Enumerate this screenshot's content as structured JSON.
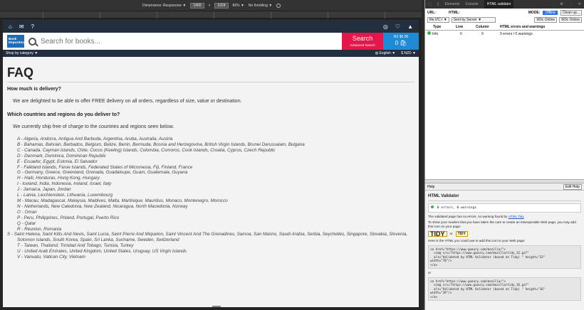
{
  "devbar": {
    "mode": "Dimensions: Responsive ▼",
    "width": "1400",
    "x": "×",
    "height": "1024",
    "zoom": "86% ▼",
    "throttle": "No throttling ▼"
  },
  "store": {
    "search_placeholder": "Search for books...",
    "search_button": "Search",
    "advanced": "Advanced Search",
    "basket_total": "NZ $0.00",
    "basket_count": "0",
    "logo_line1": "Book",
    "logo_line2": "Depository",
    "shop_by_category": "Shop by category ▼",
    "language": "English ▼",
    "currency": "$ NZD ▼"
  },
  "faq": {
    "title": "FAQ",
    "q1": "How much is delivery?",
    "a1": "We are delighted to be able to offer FREE delivery on all orders, regardless of size, value or destination.",
    "q2": "Which countries and regions do you deliver to?",
    "a2": "We currently ship free of charge to the countries and regions seen below.",
    "countries": [
      "A - Algeria, Andorra, Antigua And Barbuda, Argentina, Aruba, Australia, Austria",
      "B - Bahamas, Bahrain, Barbados, Belgium, Belize, Benin, Bermuda, Bosnia and Herzegovina, British Virgin Islands, Brunei Darussalam, Bulgaria",
      "C - Canada, Cayman Islands, Chile, Cocos (Keeling) Islands, Colombia, Comoros, Cook Islands, Croatia, Cyprus, Czech Republic",
      "D - Denmark, Dominica, Dominican Republic",
      "E - Ecuador, Egypt, Estonia, El Salvador",
      "F - Falkland Islands, Faroe Islands, Federated States of Micronesia, Fiji, Finland, France",
      "G - Germany, Greece, Greenland, Grenada, Guadaloupe, Guam, Guatemala, Guyana",
      "H - Haiti, Honduras, Hong Kong, Hungary",
      "I - Iceland, India, Indonesia, Ireland, Israel, Italy",
      "J - Jamaica, Japan, Jordan",
      "L - Latvia, Liechtenstein, Lithuania, Luxembourg",
      "M - Macau, Madagascar, Malaysia, Maldives, Malta, Martinique, Mauritius, Monaco, Montenegro, Morocco",
      "N - Netherlands, New Caledonia, New Zealand, Nicaragua, North Macedonia, Norway",
      "O - Oman",
      "P - Peru, Philippines, Poland, Portugal, Puerto Rico",
      "Q - Qatar",
      "R - Reunion, Romania",
      "S - Saint Helena, Saint Kitts And Nevis, Saint Lucia, Saint Pierre And Miquelon, Saint Vincent And The Grenadines, Samoa, San Marino, Saudi Arabia, Serbia, Seychelles, Singapore, Slovakia, Slovenia, Solomon Islands, South Korea, Spain, Sri Lanka, Suriname, Sweden, Switzerland",
      "T - Taiwan, Thailand, Trinidad And Tobago, Tunisia, Turkey",
      "U - United Arab Emirates, United Kingdom, United States, Uruguay, US Virgin Islands",
      "V - Vanuatu, Vatican City, Vietnam"
    ]
  },
  "devtools": {
    "tabs": [
      "Elements",
      "Console",
      "HTML validator"
    ],
    "url_label": "URL:",
    "html_label": "HTML:",
    "mode_label": "MODE:",
    "mode_value": "Offline",
    "clean_button": "Clean up...",
    "url_value": "file:///C:/ ▼",
    "html_value": "Sent by Server ▼",
    "w3c_1": "W3c Online",
    "w3c_2": "W3c Online",
    "col_type": "Type",
    "col_line": "Line",
    "col_column": "Column",
    "col_html": "HTML errors and warnings",
    "row_type": "Info",
    "row_line": "0",
    "row_col": "0",
    "row_msg": "0 errors / 0 warnings",
    "help_label": "Help",
    "edit_help": "Edit Help",
    "validator_title": "HTML Validator",
    "status": "0 errors, 0 warnings",
    "desc1_pre": "The validated page has no errors, no warning found by",
    "desc1_link": "HTML Tidy",
    "desc2": "To show your readers that you have taken the care to create an interoperable Web page, you may add this icon on your page:",
    "tidy_big": "TIDY",
    "tidy_or": "or",
    "tidy_small": "TIDY",
    "desc3": "Here is the HTML you could use to add this icon to your Web page:",
    "code1": "<a href=\"https://www.gueury.com/mozilla/\">\n  <img src=\"https://www.gueury.com/mozilla/tidy_32.gif\"\n  alt=\"Validated by HTML Validator (based on Tidy) \" height=\"32\"\nwidth=\"78\"/>\n</a>",
    "or": "or",
    "code2": "<a href=\"https://www.gueury.com/mozilla/\">\n  <img src=\"https://www.gueury.com/mozilla/tidy_16.gif\"\n  alt=\"Validated by HTML Validator (based on Tidy) \" height=\"16\"\nwidth=\"39\"/>\n</a>"
  },
  "colors": {
    "navy": "#232f3e",
    "search_red": "#e4164a",
    "basket_blue": "#1f8ad6",
    "offline_blue": "#2f70e8"
  }
}
